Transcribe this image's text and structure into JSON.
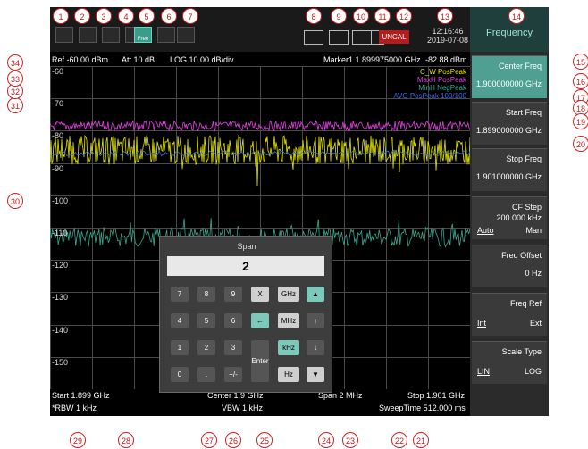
{
  "header": {
    "ref": "Ref -60.00 dBm",
    "att": "Att 10 dB",
    "scale": "LOG 10.00 dB/div",
    "marker": "Marker1 1.899975000 GHz",
    "marker_value": "-82.88 dBm"
  },
  "status": {
    "uncal": "UNCAL",
    "time": "12:16:46",
    "date": "2019-07-08",
    "free_label": "Free"
  },
  "y_ticks": [
    "-60",
    "-70",
    "-80",
    "-90",
    "-100",
    "-110",
    "-120",
    "-130",
    "-140",
    "-150"
  ],
  "legend": [
    {
      "text": "C_W PosPeak",
      "color": "#e6e600"
    },
    {
      "text": "MaxH PosPeak",
      "color": "#e040e0"
    },
    {
      "text": "MinH NegPeak",
      "color": "#3aa890"
    },
    {
      "text": "AVG PosPeak 100/100",
      "color": "#3a6cf0"
    }
  ],
  "footer": {
    "start": "Start 1.899 GHz",
    "rbw": "*RBW 1 kHz",
    "center": "Center 1.9 GHz",
    "vbw": "VBW 1 kHz",
    "span": "Span 2 MHz",
    "stop": "Stop 1.901 GHz",
    "sweep": "SweepTime 512.000 ms"
  },
  "softmenu": {
    "title": "Frequency",
    "center": {
      "label": "Center Freq",
      "value": "1.900000000 GHz"
    },
    "start": {
      "label": "Start Freq",
      "value": "1.899000000 GHz"
    },
    "stop": {
      "label": "Stop Freq",
      "value": "1.901000000 GHz"
    },
    "cf_step": {
      "label": "CF Step",
      "value": "200.000 kHz",
      "opt_l": "Auto",
      "opt_r": "Man"
    },
    "offset": {
      "label": "Freq Offset",
      "value": "0 Hz"
    },
    "ref": {
      "label": "Freq Ref",
      "opt_l": "Int",
      "opt_r": "Ext"
    },
    "scale": {
      "label": "Scale Type",
      "opt_l": "LIN",
      "opt_r": "LOG"
    }
  },
  "dialog": {
    "title": "Span",
    "input": "2",
    "keys": {
      "k7": "7",
      "k8": "8",
      "k9": "9",
      "kx": "X",
      "kghz": "GHz",
      "kup": "▲",
      "k4": "4",
      "k5": "5",
      "k6": "6",
      "kback": "←",
      "kmhz": "MHz",
      "kuparrow": "↑",
      "k1": "1",
      "k2": "2",
      "k3": "3",
      "kenter": "Enter",
      "kkhz": "kHz",
      "kdownarrow": "↓",
      "k0": "0",
      "kdot": ".",
      "kpm": "+/-",
      "khz": "Hz",
      "kdown": "▼"
    }
  },
  "callouts": [
    "1",
    "2",
    "3",
    "4",
    "5",
    "6",
    "7",
    "8",
    "9",
    "10",
    "11",
    "12",
    "13",
    "14",
    "15",
    "16",
    "17",
    "18",
    "19",
    "20",
    "21",
    "22",
    "23",
    "24",
    "25",
    "26",
    "27",
    "28",
    "29",
    "30",
    "31",
    "32",
    "33",
    "34"
  ]
}
